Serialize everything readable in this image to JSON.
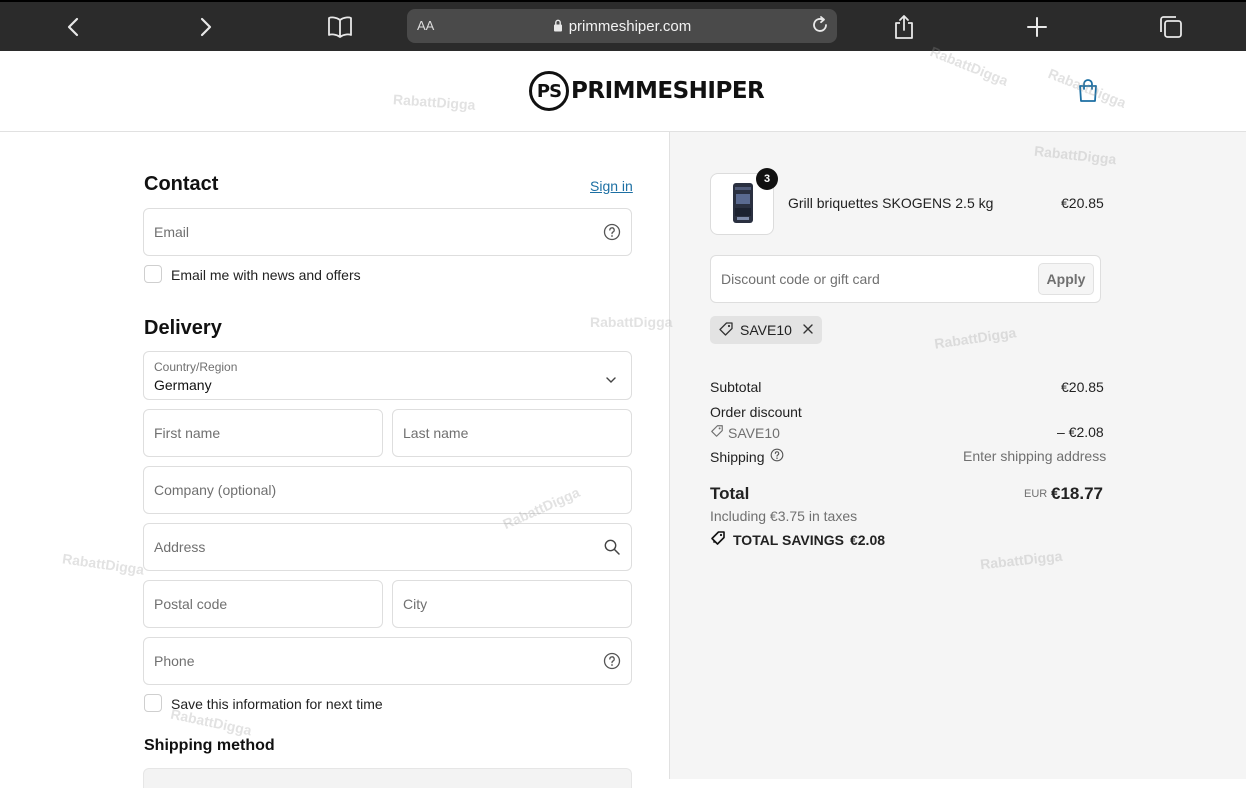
{
  "browser": {
    "aa_label": "AA",
    "url": "primmeshiper.com"
  },
  "header": {
    "logo_mark": "PS",
    "logo_text": "PRIMMESHIPER"
  },
  "watermark_text": "RabattDigga",
  "contact": {
    "title": "Contact",
    "sign_in": "Sign in",
    "email_placeholder": "Email",
    "news_label": "Email me with news and offers"
  },
  "delivery": {
    "title": "Delivery",
    "country_label": "Country/Region",
    "country_value": "Germany",
    "first_name": "First name",
    "last_name": "Last name",
    "company": "Company (optional)",
    "address": "Address",
    "postal_code": "Postal code",
    "city": "City",
    "phone": "Phone",
    "save_label": "Save this information for next time"
  },
  "shipping_method": {
    "title": "Shipping method"
  },
  "summary": {
    "product": {
      "name": "Grill briquettes SKOGENS 2.5 kg",
      "price": "€20.85",
      "quantity": "3"
    },
    "discount_placeholder": "Discount code or gift card",
    "apply_label": "Apply",
    "applied_code": "SAVE10",
    "subtotal_label": "Subtotal",
    "subtotal_value": "€20.85",
    "order_discount_label": "Order discount",
    "order_discount_code": "SAVE10",
    "order_discount_value": "– €2.08",
    "shipping_label": "Shipping",
    "shipping_value": "Enter shipping address",
    "total_label": "Total",
    "total_currency": "EUR",
    "total_value": "€18.77",
    "taxes_note": "Including €3.75 in taxes",
    "total_savings_label": "TOTAL SAVINGS",
    "total_savings_value": "€2.08"
  },
  "colors": {
    "link": "#1c6fa3",
    "browser_bar": "#2b2b2b",
    "bag_icon": "#1c6fa3",
    "summary_bg": "#f5f5f5"
  }
}
